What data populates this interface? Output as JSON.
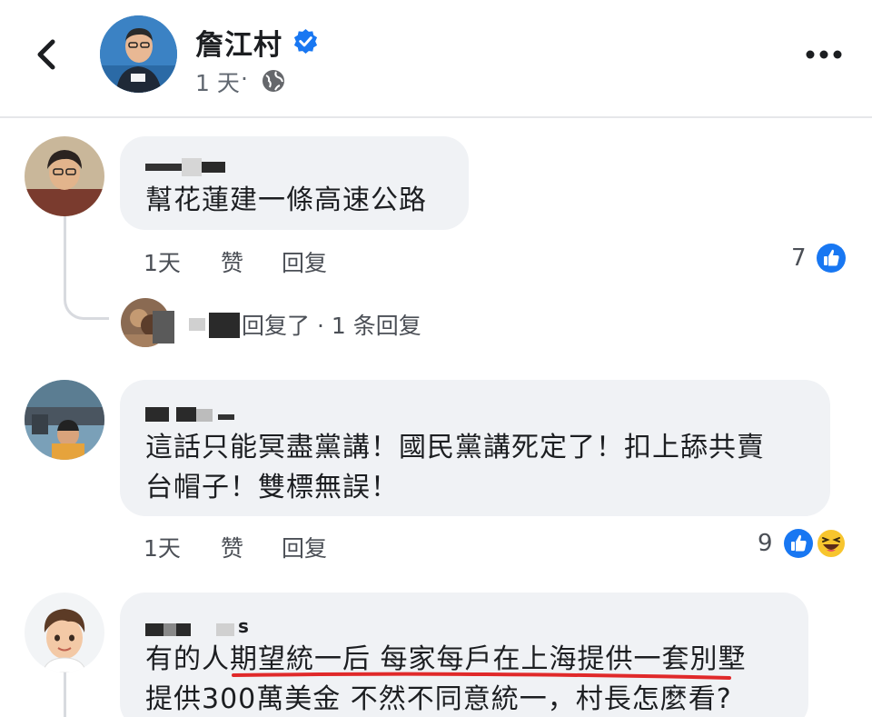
{
  "header": {
    "page_name": "詹江村",
    "time": "1 天",
    "dot": "·",
    "icons": {
      "back": "back-arrow-icon",
      "verified": "verified-badge-icon",
      "audience": "globe-icon",
      "more": "more-dots-icon"
    },
    "colors": {
      "verified": "#1877f2",
      "name": "#1c1e21",
      "meta": "#606770"
    }
  },
  "comments": [
    {
      "text_lines": [
        "幫花蓮建一條高速公路"
      ],
      "time": "1天",
      "like_label": "赞",
      "reply_label": "回复",
      "reaction_count": "7",
      "reactions": [
        "like-icon"
      ],
      "reply_preview": "回复了 · 1 条回复"
    },
    {
      "text_lines": [
        "這話只能冥盡黨講！國民黨講死定了！扣上舔共賣",
        "台帽子！雙標無誤！"
      ],
      "time": "1天",
      "like_label": "赞",
      "reply_label": "回复",
      "reaction_count": "9",
      "reactions": [
        "like-icon",
        "haha-icon"
      ]
    },
    {
      "author_suffix": "s",
      "text_lines": [
        "有的人期望統一后 每家每戶在上海提供一套別墅",
        "提供300萬美金 不然不同意統一，村長怎麼看?"
      ]
    }
  ],
  "colors": {
    "bubble": "#f0f2f5",
    "like": "#1877f2",
    "underline": "#e0292a",
    "thread": "#d8dadf"
  }
}
